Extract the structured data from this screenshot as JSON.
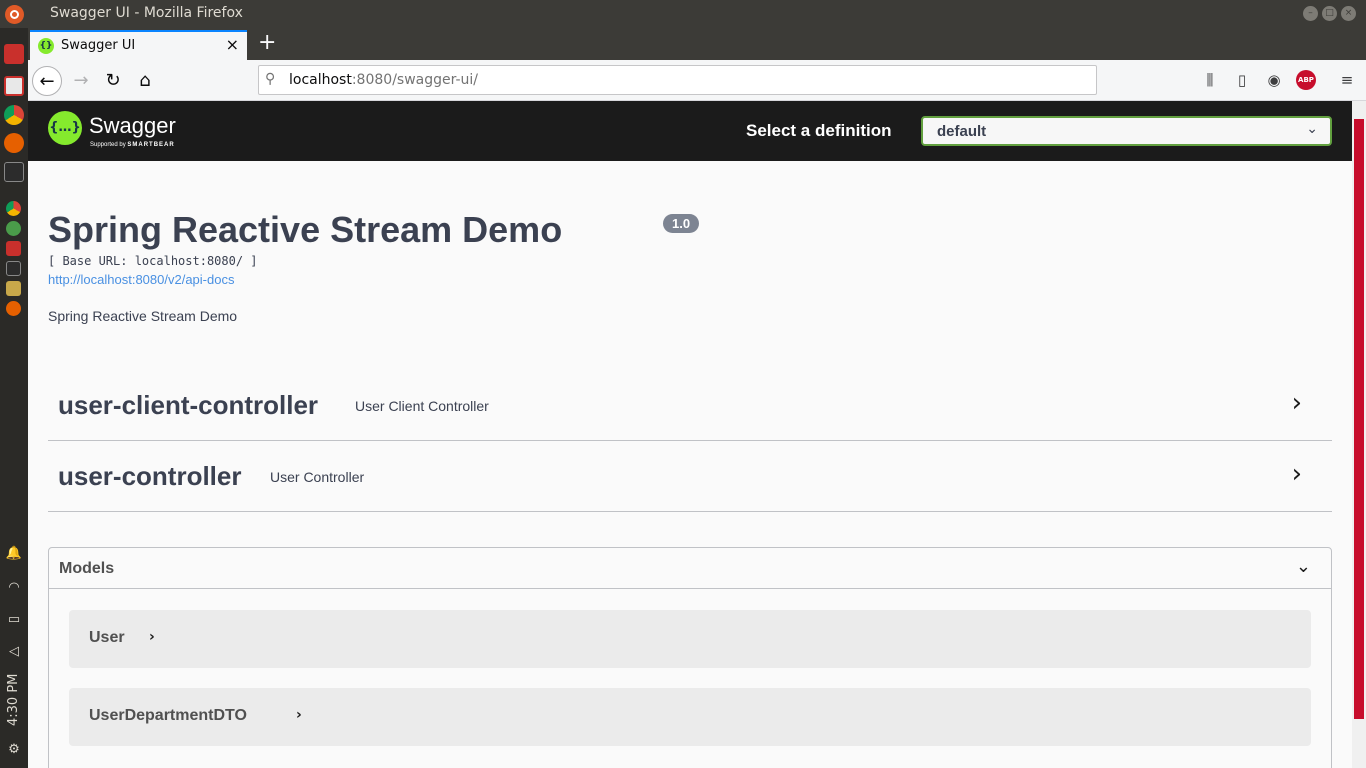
{
  "window": {
    "title": "Swagger UI - Mozilla Firefox"
  },
  "browser": {
    "tab_title": "Swagger UI",
    "url_host": "localhost",
    "url_rest": ":8080/swagger-ui/"
  },
  "taskbar": {
    "clock": "4:30 PM"
  },
  "swagger": {
    "brand": "Swagger",
    "brand_sub_prefix": "Supported by",
    "brand_sub_company": "SMARTBEAR",
    "select_label": "Select a definition",
    "select_value": "default",
    "info_title": "Spring Reactive Stream Demo",
    "version": "1.0",
    "base_url": "[ Base URL: localhost:8080/ ]",
    "api_docs_link": "http://localhost:8080/v2/api-docs",
    "description": "Spring Reactive Stream Demo",
    "tags": [
      {
        "name": "user-client-controller",
        "description": "User Client Controller"
      },
      {
        "name": "user-controller",
        "description": "User Controller"
      }
    ],
    "models_title": "Models",
    "models": [
      {
        "name": "User"
      },
      {
        "name": "UserDepartmentDTO"
      }
    ]
  },
  "colors": {
    "swagger_green": "#85ea2d",
    "topbar": "#1b1b1b",
    "text": "#3b4151",
    "link": "#4990e2",
    "select_border": "#62a03f"
  }
}
